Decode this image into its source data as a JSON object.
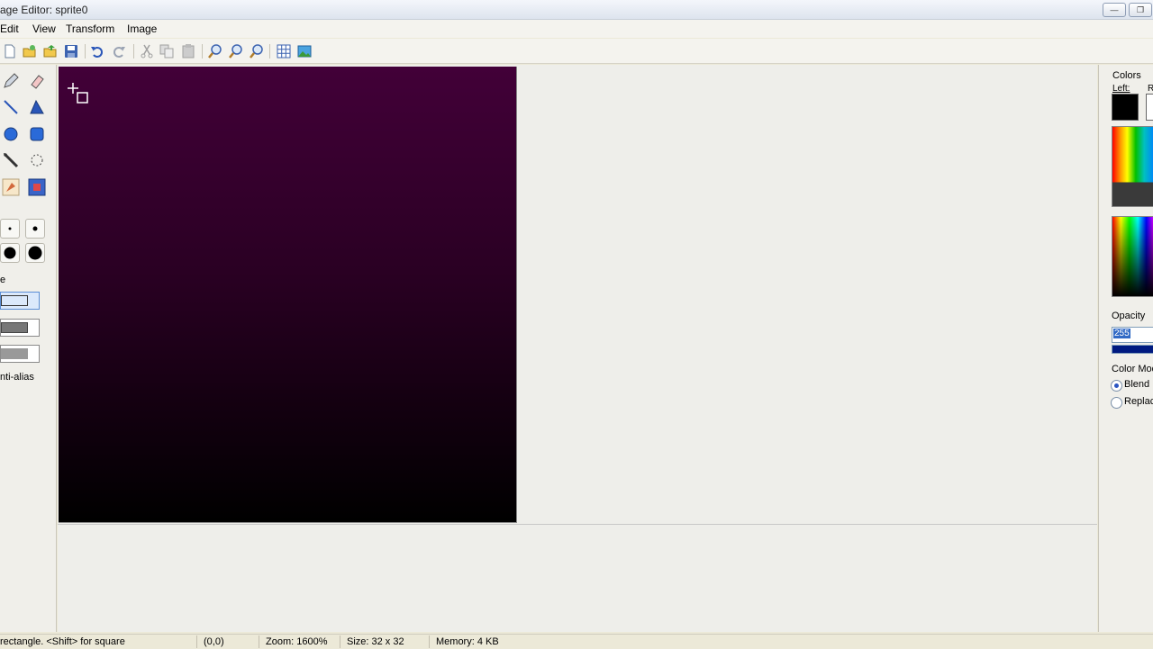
{
  "window": {
    "title": "age Editor: sprite0",
    "minimize": "—",
    "maximize": "❐"
  },
  "menu": [
    "Edit",
    "View",
    "Transform",
    "Image"
  ],
  "toolbar": {
    "buttons": [
      "new-icon",
      "open-icon",
      "open-folder-icon",
      "save-icon",
      "undo-icon",
      "redo-icon",
      "cut-icon",
      "copy-icon",
      "paste-icon",
      "zoom-in-icon",
      "zoom-out-icon",
      "zoom-actual-icon",
      "grid-icon",
      "image-preview-icon"
    ]
  },
  "tools": {
    "items": [
      "pencil-icon",
      "eraser-icon",
      "line-icon",
      "polygon-icon",
      "ellipse-icon",
      "rounded-rect-icon",
      "eyedropper-icon",
      "lasso-icon",
      "fill-icon",
      "recolor-icon"
    ],
    "fill_label": "e",
    "antialias_label": "nti-alias"
  },
  "canvas": {
    "gradient_top": "#420038",
    "gradient_bottom": "#000000"
  },
  "colors_panel": {
    "title": "Colors",
    "left_label": "Left:",
    "right_label": "R",
    "primary": "#000000",
    "secondary": "#ffffff",
    "opacity_label": "Opacity",
    "opacity_value": "255",
    "color_mode_label": "Color Mod",
    "blend_label": "Blend",
    "replace_label": "Replac"
  },
  "status": {
    "hint": "rectangle. <Shift> for square",
    "coords": "(0,0)",
    "zoom": "Zoom: 1600%",
    "size": "Size: 32 x 32",
    "memory": "Memory: 4 KB"
  }
}
